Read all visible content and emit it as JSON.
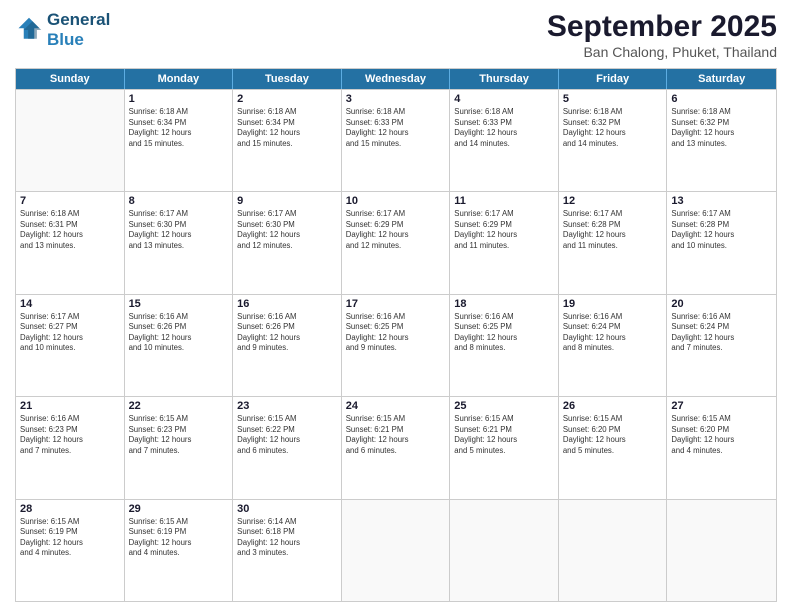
{
  "logo": {
    "line1": "General",
    "line2": "Blue"
  },
  "title": "September 2025",
  "subtitle": "Ban Chalong, Phuket, Thailand",
  "header_days": [
    "Sunday",
    "Monday",
    "Tuesday",
    "Wednesday",
    "Thursday",
    "Friday",
    "Saturday"
  ],
  "weeks": [
    [
      {
        "day": "",
        "info": ""
      },
      {
        "day": "1",
        "info": "Sunrise: 6:18 AM\nSunset: 6:34 PM\nDaylight: 12 hours\nand 15 minutes."
      },
      {
        "day": "2",
        "info": "Sunrise: 6:18 AM\nSunset: 6:34 PM\nDaylight: 12 hours\nand 15 minutes."
      },
      {
        "day": "3",
        "info": "Sunrise: 6:18 AM\nSunset: 6:33 PM\nDaylight: 12 hours\nand 15 minutes."
      },
      {
        "day": "4",
        "info": "Sunrise: 6:18 AM\nSunset: 6:33 PM\nDaylight: 12 hours\nand 14 minutes."
      },
      {
        "day": "5",
        "info": "Sunrise: 6:18 AM\nSunset: 6:32 PM\nDaylight: 12 hours\nand 14 minutes."
      },
      {
        "day": "6",
        "info": "Sunrise: 6:18 AM\nSunset: 6:32 PM\nDaylight: 12 hours\nand 13 minutes."
      }
    ],
    [
      {
        "day": "7",
        "info": "Sunrise: 6:18 AM\nSunset: 6:31 PM\nDaylight: 12 hours\nand 13 minutes."
      },
      {
        "day": "8",
        "info": "Sunrise: 6:17 AM\nSunset: 6:30 PM\nDaylight: 12 hours\nand 13 minutes."
      },
      {
        "day": "9",
        "info": "Sunrise: 6:17 AM\nSunset: 6:30 PM\nDaylight: 12 hours\nand 12 minutes."
      },
      {
        "day": "10",
        "info": "Sunrise: 6:17 AM\nSunset: 6:29 PM\nDaylight: 12 hours\nand 12 minutes."
      },
      {
        "day": "11",
        "info": "Sunrise: 6:17 AM\nSunset: 6:29 PM\nDaylight: 12 hours\nand 11 minutes."
      },
      {
        "day": "12",
        "info": "Sunrise: 6:17 AM\nSunset: 6:28 PM\nDaylight: 12 hours\nand 11 minutes."
      },
      {
        "day": "13",
        "info": "Sunrise: 6:17 AM\nSunset: 6:28 PM\nDaylight: 12 hours\nand 10 minutes."
      }
    ],
    [
      {
        "day": "14",
        "info": "Sunrise: 6:17 AM\nSunset: 6:27 PM\nDaylight: 12 hours\nand 10 minutes."
      },
      {
        "day": "15",
        "info": "Sunrise: 6:16 AM\nSunset: 6:26 PM\nDaylight: 12 hours\nand 10 minutes."
      },
      {
        "day": "16",
        "info": "Sunrise: 6:16 AM\nSunset: 6:26 PM\nDaylight: 12 hours\nand 9 minutes."
      },
      {
        "day": "17",
        "info": "Sunrise: 6:16 AM\nSunset: 6:25 PM\nDaylight: 12 hours\nand 9 minutes."
      },
      {
        "day": "18",
        "info": "Sunrise: 6:16 AM\nSunset: 6:25 PM\nDaylight: 12 hours\nand 8 minutes."
      },
      {
        "day": "19",
        "info": "Sunrise: 6:16 AM\nSunset: 6:24 PM\nDaylight: 12 hours\nand 8 minutes."
      },
      {
        "day": "20",
        "info": "Sunrise: 6:16 AM\nSunset: 6:24 PM\nDaylight: 12 hours\nand 7 minutes."
      }
    ],
    [
      {
        "day": "21",
        "info": "Sunrise: 6:16 AM\nSunset: 6:23 PM\nDaylight: 12 hours\nand 7 minutes."
      },
      {
        "day": "22",
        "info": "Sunrise: 6:15 AM\nSunset: 6:23 PM\nDaylight: 12 hours\nand 7 minutes."
      },
      {
        "day": "23",
        "info": "Sunrise: 6:15 AM\nSunset: 6:22 PM\nDaylight: 12 hours\nand 6 minutes."
      },
      {
        "day": "24",
        "info": "Sunrise: 6:15 AM\nSunset: 6:21 PM\nDaylight: 12 hours\nand 6 minutes."
      },
      {
        "day": "25",
        "info": "Sunrise: 6:15 AM\nSunset: 6:21 PM\nDaylight: 12 hours\nand 5 minutes."
      },
      {
        "day": "26",
        "info": "Sunrise: 6:15 AM\nSunset: 6:20 PM\nDaylight: 12 hours\nand 5 minutes."
      },
      {
        "day": "27",
        "info": "Sunrise: 6:15 AM\nSunset: 6:20 PM\nDaylight: 12 hours\nand 4 minutes."
      }
    ],
    [
      {
        "day": "28",
        "info": "Sunrise: 6:15 AM\nSunset: 6:19 PM\nDaylight: 12 hours\nand 4 minutes."
      },
      {
        "day": "29",
        "info": "Sunrise: 6:15 AM\nSunset: 6:19 PM\nDaylight: 12 hours\nand 4 minutes."
      },
      {
        "day": "30",
        "info": "Sunrise: 6:14 AM\nSunset: 6:18 PM\nDaylight: 12 hours\nand 3 minutes."
      },
      {
        "day": "",
        "info": ""
      },
      {
        "day": "",
        "info": ""
      },
      {
        "day": "",
        "info": ""
      },
      {
        "day": "",
        "info": ""
      }
    ]
  ]
}
